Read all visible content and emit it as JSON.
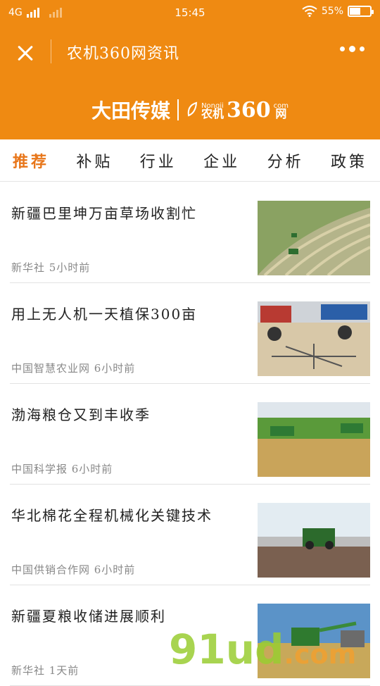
{
  "status": {
    "network": "4G",
    "time": "15:45",
    "battery": "55%",
    "battery_level": 0.55
  },
  "header": {
    "title": "农机360网资讯",
    "brand": "大田传媒",
    "brand_small_top": "Nongji",
    "brand_small": "农机",
    "brand_num": "360",
    "brand_suffix": "com",
    "brand_net": "网"
  },
  "tabs": [
    {
      "label": "推荐",
      "active": true
    },
    {
      "label": "补贴"
    },
    {
      "label": "行业"
    },
    {
      "label": "企业"
    },
    {
      "label": "分析"
    },
    {
      "label": "政策"
    }
  ],
  "news": [
    {
      "title": "新疆巴里坤万亩草场收割忙",
      "meta": "新华社 5小时前"
    },
    {
      "title": "用上无人机一天植保300亩",
      "meta": "中国智慧农业网 6小时前"
    },
    {
      "title": "渤海粮仓又到丰收季",
      "meta": "中国科学报 6小时前"
    },
    {
      "title": "华北棉花全程机械化关键技术",
      "meta": "中国供销合作网 6小时前"
    },
    {
      "title": "新疆夏粮收储进展顺利",
      "meta": "新华社 1天前"
    }
  ],
  "watermark": {
    "main": "91ud",
    "suffix": ".com"
  }
}
